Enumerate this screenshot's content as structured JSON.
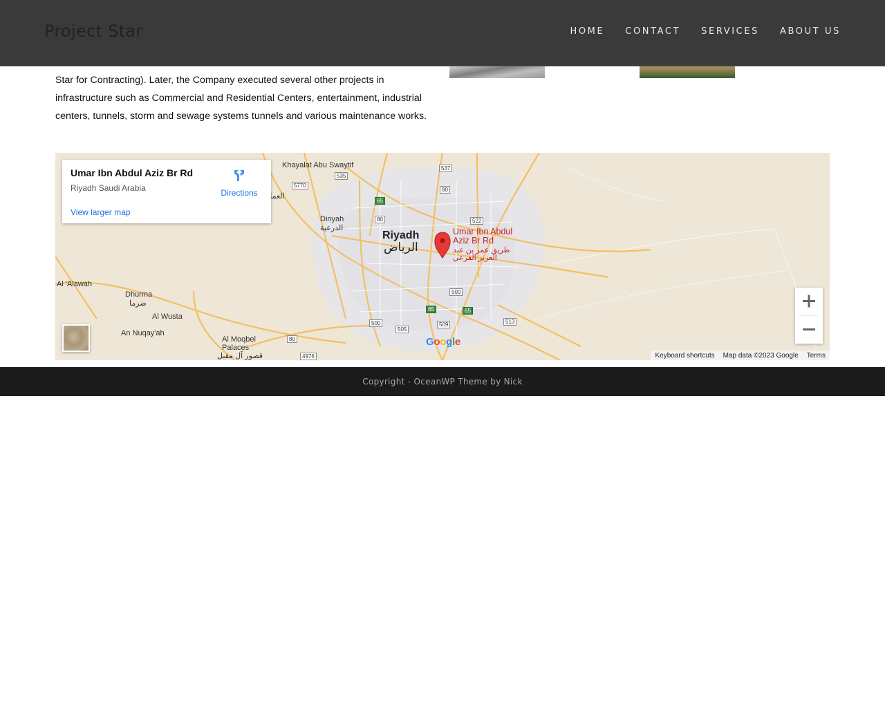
{
  "header": {
    "logo": "Project Star",
    "nav": [
      "HOME",
      "CONTACT",
      "SERVICES",
      "ABOUT US"
    ]
  },
  "about": {
    "paragraph": "Star for Contracting). Later, the Company executed several other projects in infrastructure such as Commercial and Residential Centers, entertainment, industrial centers, tunnels, storm and sewage systems tunnels and various maintenance works."
  },
  "map": {
    "info": {
      "title": "Umar Ibn Abdul Aziz Br Rd",
      "address": "Riyadh Saudi Arabia",
      "view_larger": "View larger map",
      "directions": "Directions"
    },
    "pin_label": "Umar Ibn Abdul Aziz Br Rd",
    "pin_label_ar": "طريق عمر بن عبد العزيز الفرعي",
    "places": {
      "riyadh": "Riyadh",
      "riyadh_ar": "الرياض",
      "khayalat": "Khayalat Abu Swaytif",
      "diriyah": "Diriyah",
      "diriyah_ar": "الدرعية",
      "alawah": "Al 'Alawah",
      "dhurma": "Dhurma",
      "dhurma_ar": "ضرما",
      "al_wusta": "Al Wusta",
      "an_nuqayah": "An Nuqay'ah",
      "al_moqbel": "Al Moqbel Palaces",
      "al_moqbel_ar": "قصور آل مقبل",
      "ammariyah_ar": "العمارية"
    },
    "shields": [
      "535",
      "537",
      "5770",
      "80",
      "65",
      "80",
      "522",
      "500",
      "65",
      "65",
      "500",
      "505",
      "509",
      "513",
      "80",
      "4976"
    ],
    "attribution": {
      "shortcuts": "Keyboard shortcuts",
      "data": "Map data ©2023 Google",
      "terms": "Terms"
    },
    "google": "Google",
    "colors": {
      "land": "#eee6d6",
      "urban": "#e8e8ea",
      "highway": "#f6c86b",
      "pin": "#e53935"
    }
  },
  "footer": {
    "copyright": "Copyright - OceanWP Theme by Nick"
  }
}
